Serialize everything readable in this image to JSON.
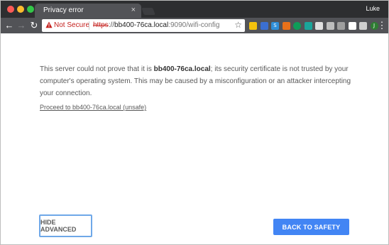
{
  "window": {
    "tab_title": "Privacy error",
    "tab_close": "×",
    "profile_name": "Luke"
  },
  "toolbar": {
    "not_secure_label": "Not Secure",
    "url_scheme": "https",
    "url_sep": "://",
    "url_host": "bb400-76ca.local",
    "url_path": ":9090/wifi-config",
    "bookmark_icon": "star-icon",
    "extensions": [
      {
        "name": "notes-extension-icon",
        "color": "#f4c20d",
        "glyph": ""
      },
      {
        "name": "mail-extension-icon",
        "color": "#3b6fd1",
        "glyph": ""
      },
      {
        "name": "s-extension-icon",
        "color": "#2f8fd8",
        "glyph": "S"
      },
      {
        "name": "tools-extension-icon",
        "color": "#e8711a",
        "glyph": ""
      },
      {
        "name": "green-circle-extension-icon",
        "color": "#0f9d58",
        "glyph": ""
      },
      {
        "name": "teal-extension-icon",
        "color": "#1aa59a",
        "glyph": ""
      },
      {
        "name": "document-extension-icon",
        "color": "#e0e0e0",
        "glyph": ""
      },
      {
        "name": "square-extension-icon",
        "color": "#bdbdbd",
        "glyph": ""
      },
      {
        "name": "off-extension-icon",
        "color": "#9e9e9e",
        "glyph": ""
      },
      {
        "name": "chat-extension-icon",
        "color": "#ffffff",
        "glyph": ""
      },
      {
        "name": "cast-icon",
        "color": "#cfcfcf",
        "glyph": ""
      },
      {
        "name": "j-extension-icon",
        "color": "#2e7d32",
        "glyph": "J"
      }
    ],
    "menu_icon": "⋮"
  },
  "content": {
    "body_pre": "This server could not prove that it is ",
    "body_host": "bb400-76ca.local",
    "body_post": "; its security certificate is not trusted by your computer's operating system. This may be caused by a misconfiguration or an attacker intercepting your connection.",
    "proceed_link": "Proceed to bb400-76ca.local (unsafe)",
    "hide_advanced_label": "HIDE ADVANCED",
    "back_to_safety_label": "BACK TO SAFETY"
  },
  "colors": {
    "primary_button": "#4285f4",
    "warning_red": "#c5221f",
    "focus_ring": "#6fa8e8"
  }
}
